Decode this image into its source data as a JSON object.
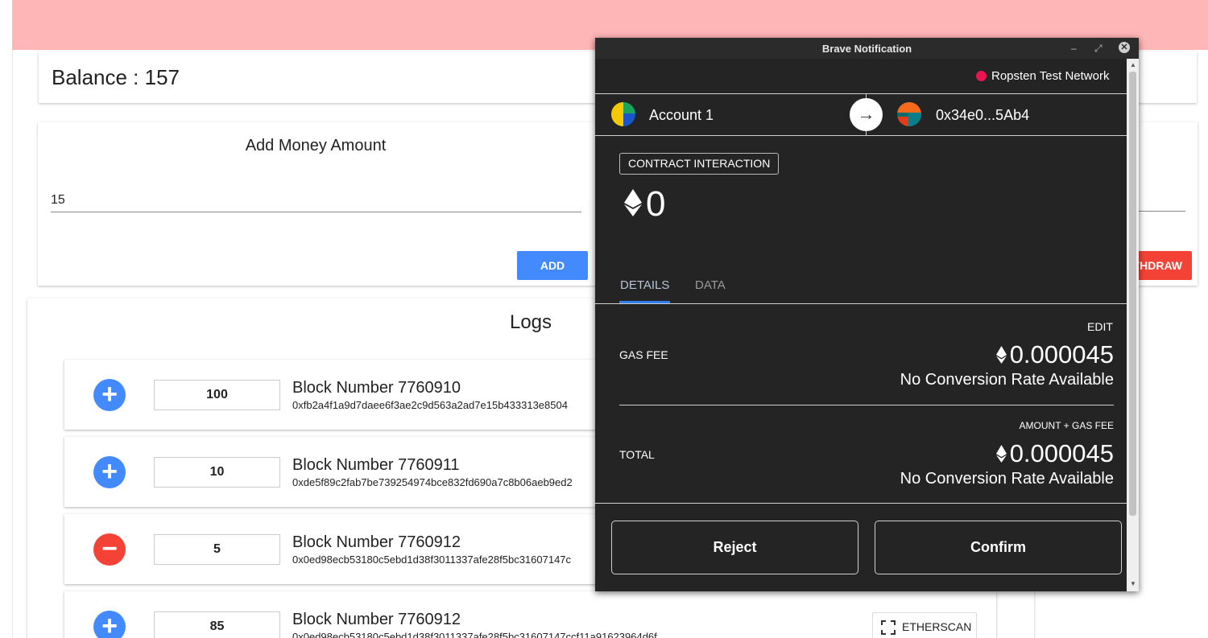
{
  "app": {
    "balance_label": "Balance : 157",
    "add_money": {
      "title": "Add Money Amount",
      "value": "15",
      "add_label": "ADD",
      "withdraw_label": "THDRAW"
    },
    "logs": {
      "title": "Logs",
      "etherscan_label": "ETHERSCAN",
      "items": [
        {
          "type": "plus",
          "amount": "100",
          "block": "Block Number 7760910",
          "hash": "0xfb2a4f1a9d7daee6f3ae2c9d563a2ad7e15b433313e8504"
        },
        {
          "type": "plus",
          "amount": "10",
          "block": "Block Number 7760911",
          "hash": "0xde5f89c2fab7be739254974bce832fd690a7c8b06aeb9ed2"
        },
        {
          "type": "minus",
          "amount": "5",
          "block": "Block Number 7760912",
          "hash": "0x0ed98ecb53180c5ebd1d38f3011337afe28f5bc31607147c"
        },
        {
          "type": "plus",
          "amount": "85",
          "block": "Block Number 7760912",
          "hash": "0x0ed98ecb53180c5ebd1d38f3011337afe28f5bc31607147ccf11a91623964d6f"
        }
      ]
    },
    "colors": {
      "header": "#ffb6b6",
      "primary": "#448aff",
      "danger": "#f44336"
    }
  },
  "notification": {
    "window_title": "Brave Notification",
    "controls": {
      "minimize": "–",
      "maximize": "⤢",
      "close": "✕"
    },
    "network": "Ropsten Test Network",
    "from_account": "Account 1",
    "to_address": "0x34e0...5Ab4",
    "arrow": "→",
    "badge": "CONTRACT INTERACTION",
    "amount": "0",
    "tabs": [
      "DETAILS",
      "DATA"
    ],
    "active_tab": "DETAILS",
    "edit_label": "EDIT",
    "gas_fee_label": "GAS FEE",
    "gas_fee_value": "0.000045",
    "gas_fee_conversion": "No Conversion Rate Available",
    "amount_gas_label": "AMOUNT + GAS FEE",
    "total_label": "TOTAL",
    "total_value": "0.000045",
    "total_conversion": "No Conversion Rate Available",
    "reject_label": "Reject",
    "confirm_label": "Confirm",
    "colors": {
      "background": "#242424",
      "network_dot": "#e91550",
      "tab_accent": "#2f80ed"
    }
  }
}
